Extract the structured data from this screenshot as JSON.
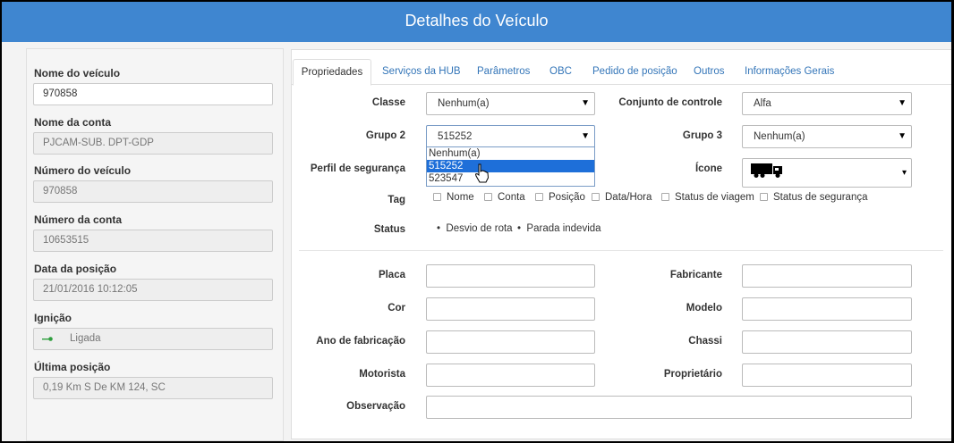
{
  "window": {
    "title": "Detalhes do Veículo"
  },
  "left_panel": {
    "fields": [
      {
        "label": "Nome do veículo",
        "value": "970858"
      },
      {
        "label": "Nome da conta",
        "value": "PJCAM-SUB. DPT-GDP"
      },
      {
        "label": "Número do veículo",
        "value": "970858"
      },
      {
        "label": "Número da conta",
        "value": "10653515"
      },
      {
        "label": "Data da posição",
        "value": "21/01/2016 10:12:05"
      },
      {
        "label": "Ignição",
        "value": "Ligada",
        "icon": "key-icon"
      },
      {
        "label": "Última posição",
        "value": "0,19 Km S De KM 124, SC"
      }
    ]
  },
  "tabs": [
    {
      "label": "Propriedades",
      "active": true
    },
    {
      "label": "Serviços da HUB"
    },
    {
      "label": "Parâmetros"
    },
    {
      "label": "OBC"
    },
    {
      "label": "Pedido de posição"
    },
    {
      "label": "Outros"
    },
    {
      "label": "Informações Gerais"
    }
  ],
  "properties": {
    "classe": {
      "label": "Classe",
      "value": "Nenhum(a)"
    },
    "conjunto": {
      "label": "Conjunto de controle",
      "value": "Alfa"
    },
    "grupo2": {
      "label": "Grupo 2",
      "value": "515252",
      "options": [
        "Nenhum(a)",
        "515252",
        "523547"
      ],
      "highlighted": "515252"
    },
    "grupo3": {
      "label": "Grupo 3",
      "value": "Nenhum(a)"
    },
    "perfil": {
      "label": "Perfil de segurança"
    },
    "icone": {
      "label": "Ícone",
      "value_icon": "truck-icon"
    },
    "tag": {
      "label": "Tag",
      "options": [
        "Nome",
        "Conta",
        "Posição",
        "Data/Hora",
        "Status de viagem",
        "Status de segurança"
      ]
    },
    "status": {
      "label": "Status",
      "items": [
        "Desvio de rota",
        "Parada indevida"
      ]
    }
  },
  "details": {
    "placa": "Placa",
    "fabricante": "Fabricante",
    "cor": "Cor",
    "modelo": "Modelo",
    "ano": "Ano de fabricação",
    "chassi": "Chassi",
    "motorista": "Motorista",
    "proprietario": "Proprietário",
    "observacao": "Observação"
  },
  "colors": {
    "header": "#3f86d0",
    "link": "#3375b8",
    "selection": "#1e6fd9",
    "ignition": "#2e9e3e"
  }
}
